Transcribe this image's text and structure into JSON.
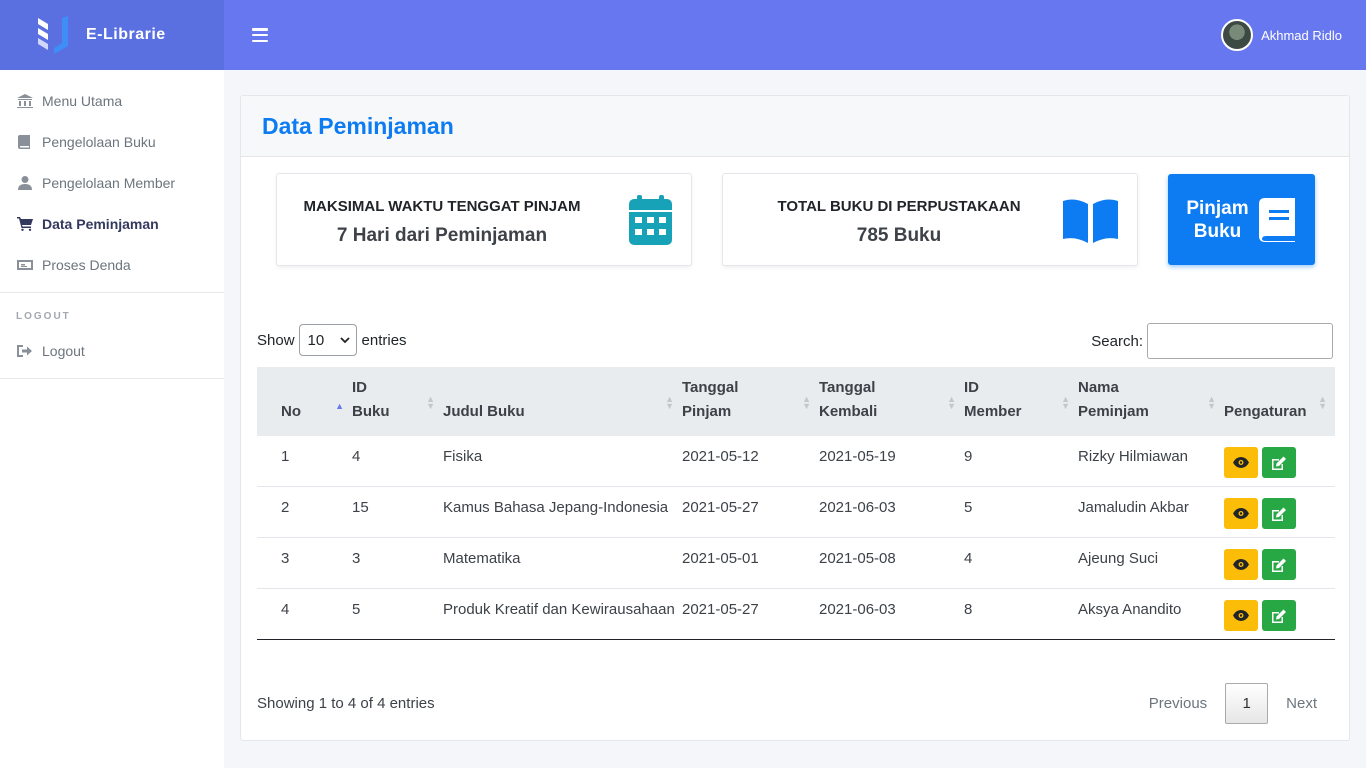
{
  "app": {
    "name": "E-Librarie"
  },
  "header": {
    "user_name": "Akhmad Ridlo"
  },
  "sidebar": {
    "items": [
      {
        "label": "Menu Utama",
        "icon": "museum-icon"
      },
      {
        "label": "Pengelolaan Buku",
        "icon": "book-icon"
      },
      {
        "label": "Pengelolaan Member",
        "icon": "user-icon"
      },
      {
        "label": "Data Peminjaman",
        "icon": "cart-icon",
        "active": true
      },
      {
        "label": "Proses Denda",
        "icon": "money-icon"
      }
    ],
    "section_header": "LOGOUT",
    "logout_label": "Logout"
  },
  "main": {
    "title": "Data Peminjaman",
    "stats": [
      {
        "label": "MAKSIMAL WAKTU TENGGAT PINJAM",
        "value": "7 Hari dari Peminjaman",
        "icon": "calendar-icon",
        "color": "#17a2b8"
      },
      {
        "label": "TOTAL BUKU DI PERPUSTAKAAN",
        "value": "785 Buku",
        "icon": "open-book-icon",
        "color": "#0d7cf2"
      }
    ],
    "action_button": {
      "line1": "Pinjam",
      "line2": "Buku",
      "icon": "book-icon"
    }
  },
  "table_controls": {
    "show_label": "Show",
    "entries_value": "10",
    "entries_label": "entries",
    "search_label": "Search:",
    "search_value": ""
  },
  "table": {
    "headers": [
      {
        "l1": "",
        "l2": "No"
      },
      {
        "l1": "ID",
        "l2": "Buku"
      },
      {
        "l1": "",
        "l2": "Judul Buku"
      },
      {
        "l1": "Tanggal",
        "l2": "Pinjam"
      },
      {
        "l1": "Tanggal",
        "l2": "Kembali"
      },
      {
        "l1": "ID",
        "l2": "Member"
      },
      {
        "l1": "Nama",
        "l2": "Peminjam"
      },
      {
        "l1": "",
        "l2": "Pengaturan"
      }
    ],
    "rows": [
      {
        "no": "1",
        "id_buku": "4",
        "judul": "Fisika",
        "tgl_pinjam": "2021-05-12",
        "tgl_kembali": "2021-05-19",
        "id_member": "9",
        "nama": "Rizky Hilmiawan"
      },
      {
        "no": "2",
        "id_buku": "15",
        "judul": "Kamus Bahasa Jepang-Indonesia",
        "tgl_pinjam": "2021-05-27",
        "tgl_kembali": "2021-06-03",
        "id_member": "5",
        "nama": "Jamaludin Akbar"
      },
      {
        "no": "3",
        "id_buku": "3",
        "judul": "Matematika",
        "tgl_pinjam": "2021-05-01",
        "tgl_kembali": "2021-05-08",
        "id_member": "4",
        "nama": "Ajeung Suci"
      },
      {
        "no": "4",
        "id_buku": "5",
        "judul": "Produk Kreatif dan Kewirausahaan",
        "tgl_pinjam": "2021-05-27",
        "tgl_kembali": "2021-06-03",
        "id_member": "8",
        "nama": "Aksya Anandito"
      }
    ]
  },
  "footer": {
    "info": "Showing 1 to 4 of 4 entries",
    "previous": "Previous",
    "current_page": "1",
    "next": "Next"
  }
}
